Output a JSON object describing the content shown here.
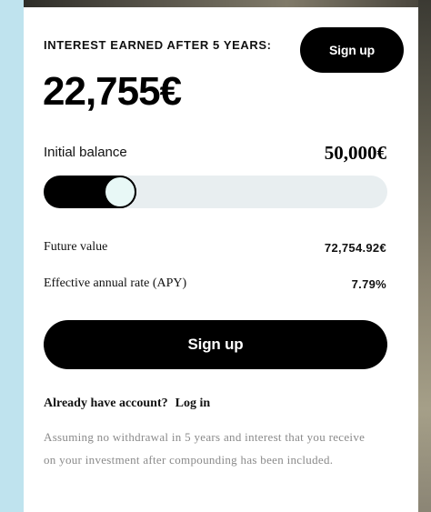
{
  "calculator": {
    "heading": "INTEREST EARNED AFTER 5 YEARS:",
    "amount": "22,755€",
    "header_button_label": "Sign up",
    "balance": {
      "label": "Initial balance",
      "value": "50,000€",
      "slider_level_fraction": 0.22
    },
    "rows": [
      {
        "label": "Future value",
        "value": "72,754.92€"
      },
      {
        "label": "Effective annual rate (APY)",
        "value": "7.79%"
      }
    ],
    "primary_button_label": "Sign up",
    "account_prompt": "Already have account?",
    "login_link": "Log in",
    "disclaimer": "Assuming no withdrawal in 5 years and interest that you receive on your investment after compounding has been included."
  },
  "colors": {
    "button_bg": "#000000",
    "button_text": "#ffffff",
    "slider_track": "#e8eef0",
    "slider_thumb": "#e8f8f6",
    "disclaimer_text": "#8a8a8a"
  }
}
